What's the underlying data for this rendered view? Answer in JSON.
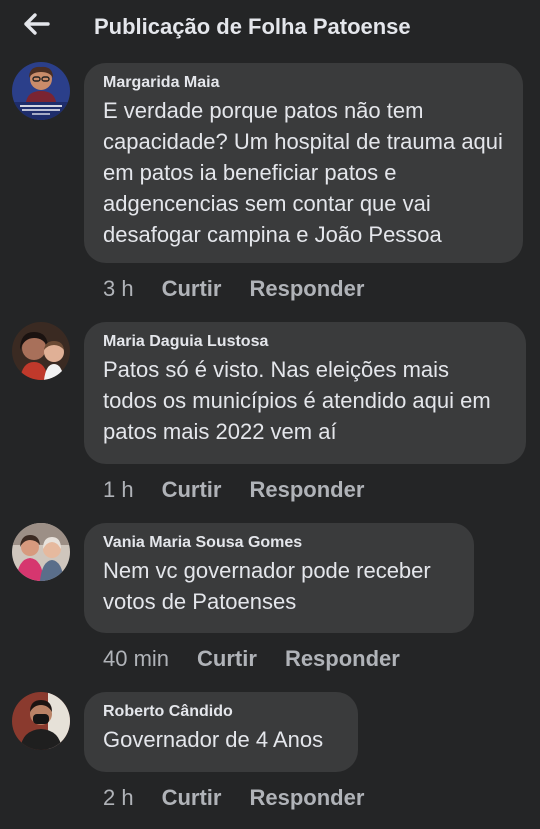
{
  "header": {
    "title": "Publicação de Folha Patoense"
  },
  "comments": [
    {
      "author": "Margarida Maia",
      "text": "E verdade porque  patos  não tem capacidade? Um  hospital de  trauma aqui em patos  ia beneficiar   patos e adgencencias  sem contar que  vai desafogar  campina e  João Pessoa",
      "time": "3 h",
      "like": "Curtir",
      "reply": "Responder"
    },
    {
      "author": "Maria Daguia Lustosa",
      "text": "Patos só é  visto. Nas eleições  mais todos os  municípios é  atendido  aqui em  patos mais 2022 vem aí",
      "time": "1 h",
      "like": "Curtir",
      "reply": "Responder"
    },
    {
      "author": "Vania Maria Sousa Gomes",
      "text": "Nem vc governador pode receber votos de Patoenses",
      "time": "40 min",
      "like": "Curtir",
      "reply": "Responder"
    },
    {
      "author": "Roberto Cândido",
      "text": "Governador de 4 Anos",
      "time": "2 h",
      "like": "Curtir",
      "reply": "Responder"
    }
  ]
}
